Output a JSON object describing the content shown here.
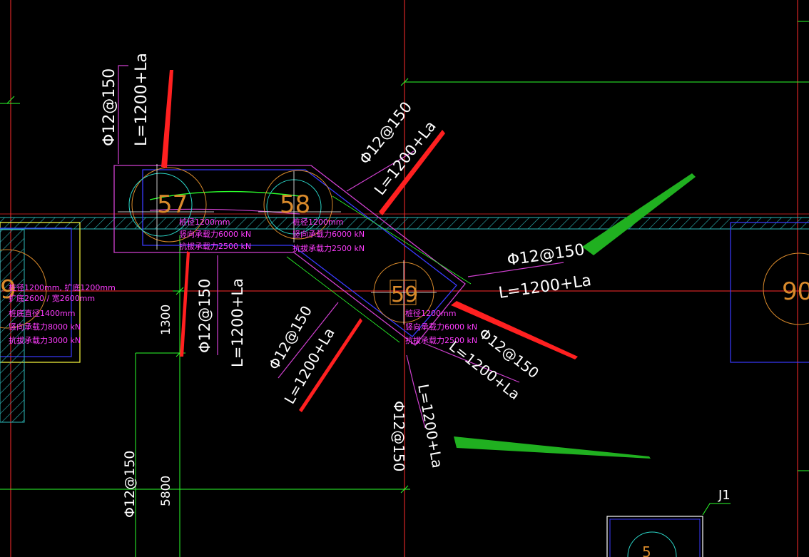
{
  "labels": {
    "bar_spec": "Φ12@150",
    "length": "L=1200+La",
    "pile_57": "57",
    "pile_58": "58",
    "pile_59": "59",
    "pile_left": "9",
    "pile_right": "90",
    "pile_bottom": "5",
    "dim_1300": "1300",
    "dim_5800": "5800",
    "j1": "J1"
  },
  "pile_notes": {
    "n1": [
      "桩径1200mm",
      "竖向承载力6000 kN",
      "抗拔承载力2500 kN"
    ],
    "n2": [
      "桩径1200mm",
      "竖向承载力6000 kN",
      "抗拔承载力2500 kN"
    ],
    "n3": [
      "桩径1200mm",
      "竖向承载力6000 kN",
      "抗拔承载力2500 kN"
    ],
    "n4": [
      "桩径1200mm, 扩底1200mm",
      "扩底2600 / 宽2600mm",
      "桩底直径1400mm",
      "竖向承载力8000 kN",
      "抗拔承载力3000 kN"
    ]
  },
  "colors": {
    "background": "#000000",
    "grid_red": "#ff2b2b",
    "grid_green": "#2bff2b",
    "pile_cap_blue": "#3a3aff",
    "outline_magenta": "#d040d0",
    "text_magenta": "#ff3cff",
    "pile_orange": "#d98a2b",
    "pile_cyan": "#2bd6c8",
    "arrow_red": "#ff2020",
    "arrow_green": "#20b020",
    "hatch_cyan": "#2bb8b8"
  }
}
